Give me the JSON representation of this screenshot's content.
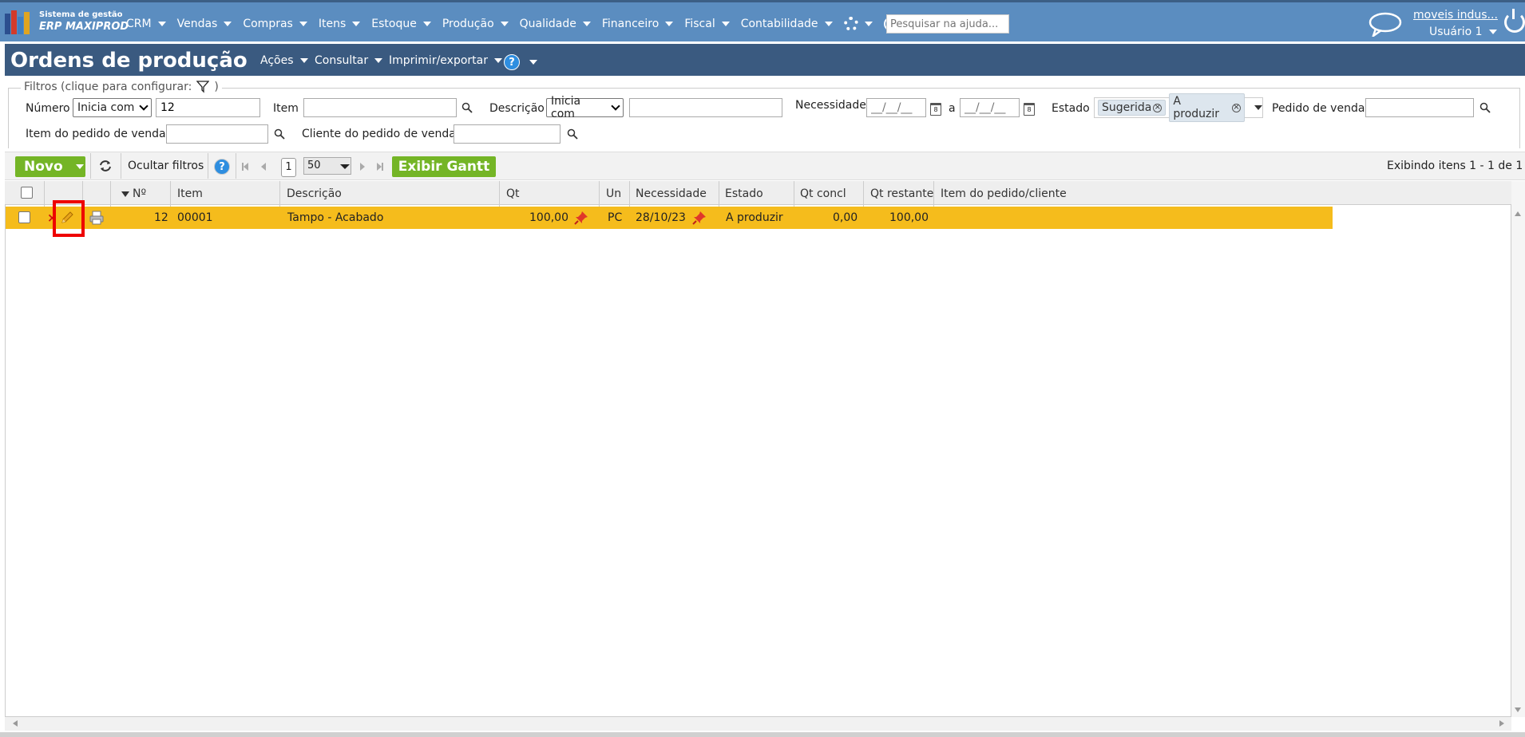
{
  "brand": {
    "line1": "Sistema de gestão",
    "line2": "ERP MAXIPROD"
  },
  "nav": {
    "items": [
      {
        "label": "CRM"
      },
      {
        "label": "Vendas"
      },
      {
        "label": "Compras"
      },
      {
        "label": "Itens"
      },
      {
        "label": "Estoque"
      },
      {
        "label": "Produção"
      },
      {
        "label": "Qualidade"
      },
      {
        "label": "Financeiro"
      },
      {
        "label": "Fiscal"
      },
      {
        "label": "Contabilidade"
      }
    ],
    "help_search_placeholder": "Pesquisar na ajuda...",
    "company": "moveis indus...",
    "user": "Usuário 1"
  },
  "page": {
    "title": "Ordens de produção",
    "menus": [
      "Ações",
      "Consultar",
      "Imprimir/exportar"
    ],
    "help_label": "?"
  },
  "filters": {
    "legend": "Filtros (clique para configurar:",
    "legend_close": ")",
    "numero_label": "Número",
    "numero_mode": "Inicia com",
    "numero_value": "12",
    "item_label": "Item",
    "descricao_label": "Descrição",
    "descricao_mode": "Inicia com",
    "necessidade_label": "Necessidade",
    "date_placeholder": "__/__/__",
    "a_label": "a",
    "estado_label": "Estado",
    "estado_tags": [
      "Sugerida",
      "A produzir"
    ],
    "pedido_label": "Pedido de venda",
    "item_pedido_label": "Item do pedido de venda",
    "cliente_label": "Cliente do pedido de venda"
  },
  "toolbar": {
    "novo": "Novo",
    "ocultar": "Ocultar filtros",
    "page": "1",
    "page_size": "50",
    "gantt": "Exibir Gantt",
    "showing": "Exibindo itens 1 - 1 de 1"
  },
  "table": {
    "columns": [
      "Nº",
      "Item",
      "Descrição",
      "Qt",
      "Un",
      "Necessidade",
      "Estado",
      "Qt concl",
      "Qt restante",
      "Item do pedido/cliente"
    ],
    "rows": [
      {
        "numero": "12",
        "item": "00001",
        "descricao": "Tampo - Acabado",
        "qt": "100,00",
        "un": "PC",
        "necessidade": "28/10/23",
        "estado": "A produzir",
        "qt_concl": "0,00",
        "qt_restante": "100,00",
        "pedido_cliente": ""
      }
    ]
  },
  "colors": {
    "nav_bg": "#5b8dc0",
    "title_bg": "#3a5a80",
    "green": "#74b526",
    "row_highlight": "#f5bc1c",
    "annotation": "#ee0000"
  }
}
